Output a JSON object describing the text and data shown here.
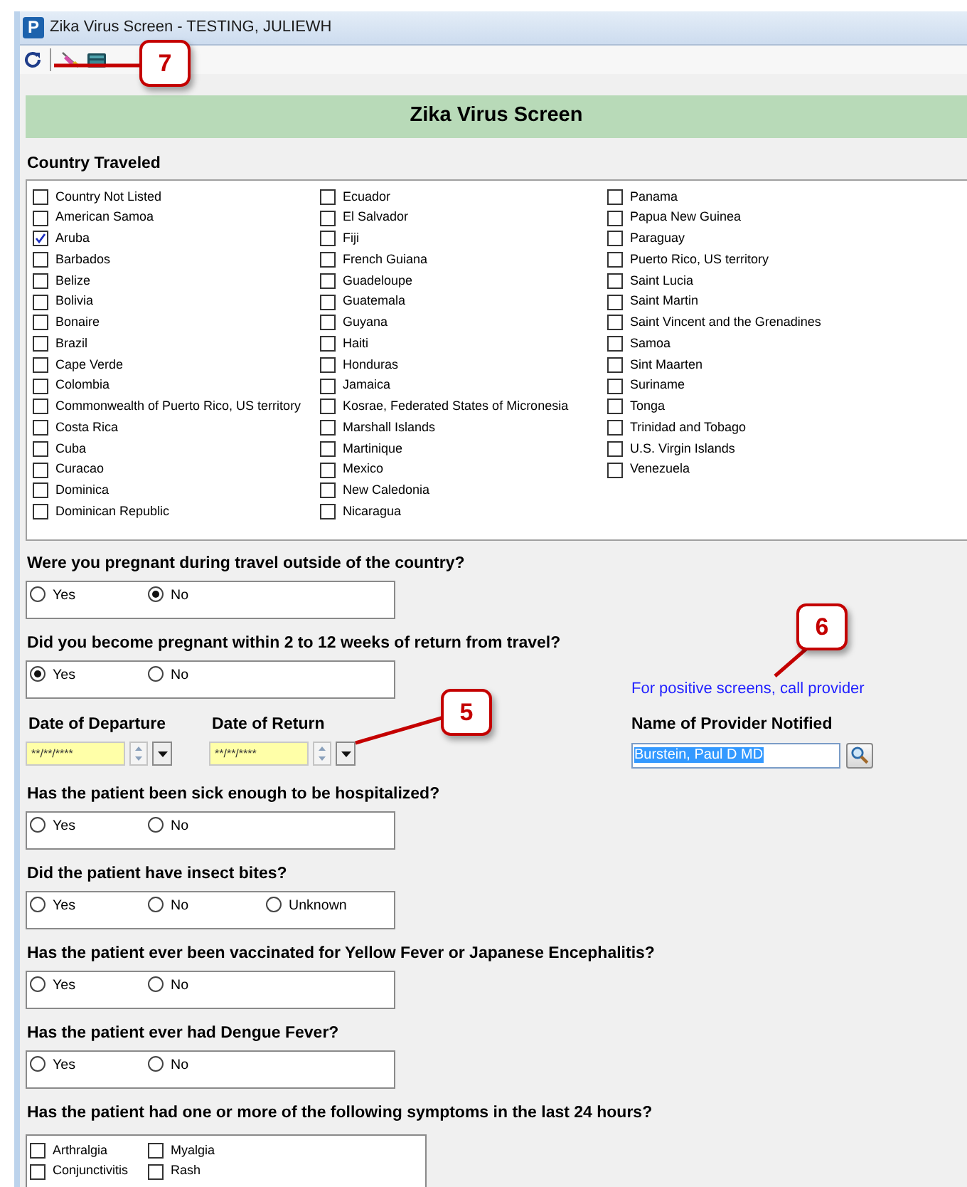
{
  "window": {
    "app_icon": "P",
    "title": "Zika Virus Screen - TESTING, JULIEWH"
  },
  "toolbar": [
    {
      "kind": "refresh"
    },
    {
      "kind": "separator"
    },
    {
      "kind": "syringe"
    },
    {
      "kind": "keyboard"
    }
  ],
  "form_title": "Zika Virus Screen",
  "country_section": {
    "label": "Country Traveled",
    "columns": [
      [
        {
          "label": "Country Not Listed",
          "checked": false
        },
        {
          "label": "American Samoa",
          "checked": false
        },
        {
          "label": "Aruba",
          "checked": true
        },
        {
          "label": "Barbados",
          "checked": false
        },
        {
          "label": "Belize",
          "checked": false
        },
        {
          "label": "Bolivia",
          "checked": false
        },
        {
          "label": "Bonaire",
          "checked": false
        },
        {
          "label": "Brazil",
          "checked": false
        },
        {
          "label": "Cape Verde",
          "checked": false
        },
        {
          "label": "Colombia",
          "checked": false
        },
        {
          "label": "Commonwealth of Puerto Rico, US territory",
          "checked": false
        },
        {
          "label": "Costa Rica",
          "checked": false
        },
        {
          "label": "Cuba",
          "checked": false
        },
        {
          "label": "Curacao",
          "checked": false
        },
        {
          "label": "Dominica",
          "checked": false
        },
        {
          "label": "Dominican Republic",
          "checked": false
        }
      ],
      [
        {
          "label": "Ecuador",
          "checked": false
        },
        {
          "label": "El Salvador",
          "checked": false
        },
        {
          "label": "Fiji",
          "checked": false
        },
        {
          "label": "French Guiana",
          "checked": false
        },
        {
          "label": "Guadeloupe",
          "checked": false
        },
        {
          "label": "Guatemala",
          "checked": false
        },
        {
          "label": "Guyana",
          "checked": false
        },
        {
          "label": "Haiti",
          "checked": false
        },
        {
          "label": "Honduras",
          "checked": false
        },
        {
          "label": "Jamaica",
          "checked": false
        },
        {
          "label": "Kosrae, Federated States of Micronesia",
          "checked": false
        },
        {
          "label": "Marshall Islands",
          "checked": false
        },
        {
          "label": "Martinique",
          "checked": false
        },
        {
          "label": "Mexico",
          "checked": false
        },
        {
          "label": "New Caledonia",
          "checked": false
        },
        {
          "label": "Nicaragua",
          "checked": false
        }
      ],
      [
        {
          "label": "Panama",
          "checked": false
        },
        {
          "label": "Papua New Guinea",
          "checked": false
        },
        {
          "label": "Paraguay",
          "checked": false
        },
        {
          "label": "Puerto Rico, US territory",
          "checked": false
        },
        {
          "label": "Saint Lucia",
          "checked": false
        },
        {
          "label": "Saint Martin",
          "checked": false
        },
        {
          "label": "Saint Vincent and the Grenadines",
          "checked": false
        },
        {
          "label": "Samoa",
          "checked": false
        },
        {
          "label": "Sint Maarten",
          "checked": false
        },
        {
          "label": "Suriname",
          "checked": false
        },
        {
          "label": "Tonga",
          "checked": false
        },
        {
          "label": "Trinidad and Tobago",
          "checked": false
        },
        {
          "label": "U.S. Virgin Islands",
          "checked": false
        },
        {
          "label": "Venezuela",
          "checked": false
        }
      ]
    ]
  },
  "sections": [
    {
      "kind": "radio",
      "text": "Were you pregnant during travel outside of the country?",
      "options": [
        {
          "label": "Yes",
          "selected": false
        },
        {
          "label": "No",
          "selected": true
        }
      ]
    },
    {
      "kind": "radio",
      "text": "Did you become pregnant within 2 to 12 weeks of return from travel?",
      "options": [
        {
          "label": "Yes",
          "selected": true
        },
        {
          "label": "No",
          "selected": false
        }
      ]
    },
    {
      "kind": "dates",
      "fields": [
        {
          "label": "Date of Departure",
          "value": "**/**/****"
        },
        {
          "label": "Date of Return",
          "value": "**/**/****"
        }
      ],
      "provider": {
        "note": "For positive screens, call provider",
        "label": "Name of Provider Notified",
        "value": "Burstein, Paul D MD",
        "text_selected": true
      }
    },
    {
      "kind": "radio",
      "text": "Has the patient been sick enough to be hospitalized?",
      "options": [
        {
          "label": "Yes",
          "selected": false
        },
        {
          "label": "No",
          "selected": false
        }
      ]
    },
    {
      "kind": "radio",
      "text": "Did the patient have insect bites?",
      "options": [
        {
          "label": "Yes",
          "selected": false
        },
        {
          "label": "No",
          "selected": false
        },
        {
          "label": "Unknown",
          "selected": false
        }
      ]
    },
    {
      "kind": "radio",
      "text": "Has the patient ever been vaccinated for Yellow Fever or Japanese Encephalitis?",
      "options": [
        {
          "label": "Yes",
          "selected": false
        },
        {
          "label": "No",
          "selected": false
        }
      ]
    },
    {
      "kind": "radio",
      "text": "Has the patient ever had Dengue Fever?",
      "options": [
        {
          "label": "Yes",
          "selected": false
        },
        {
          "label": "No",
          "selected": false
        }
      ]
    },
    {
      "kind": "checks",
      "text": "Has the patient had one or more of the following symptoms in the last 24 hours?",
      "columns": [
        [
          {
            "label": "Arthralgia",
            "checked": false
          },
          {
            "label": "Conjunctivitis",
            "checked": false
          }
        ],
        [
          {
            "label": "Myalgia",
            "checked": false
          },
          {
            "label": "Rash",
            "checked": false
          }
        ]
      ]
    }
  ],
  "callouts": [
    {
      "number": "7"
    },
    {
      "number": "6"
    },
    {
      "number": "5"
    }
  ]
}
